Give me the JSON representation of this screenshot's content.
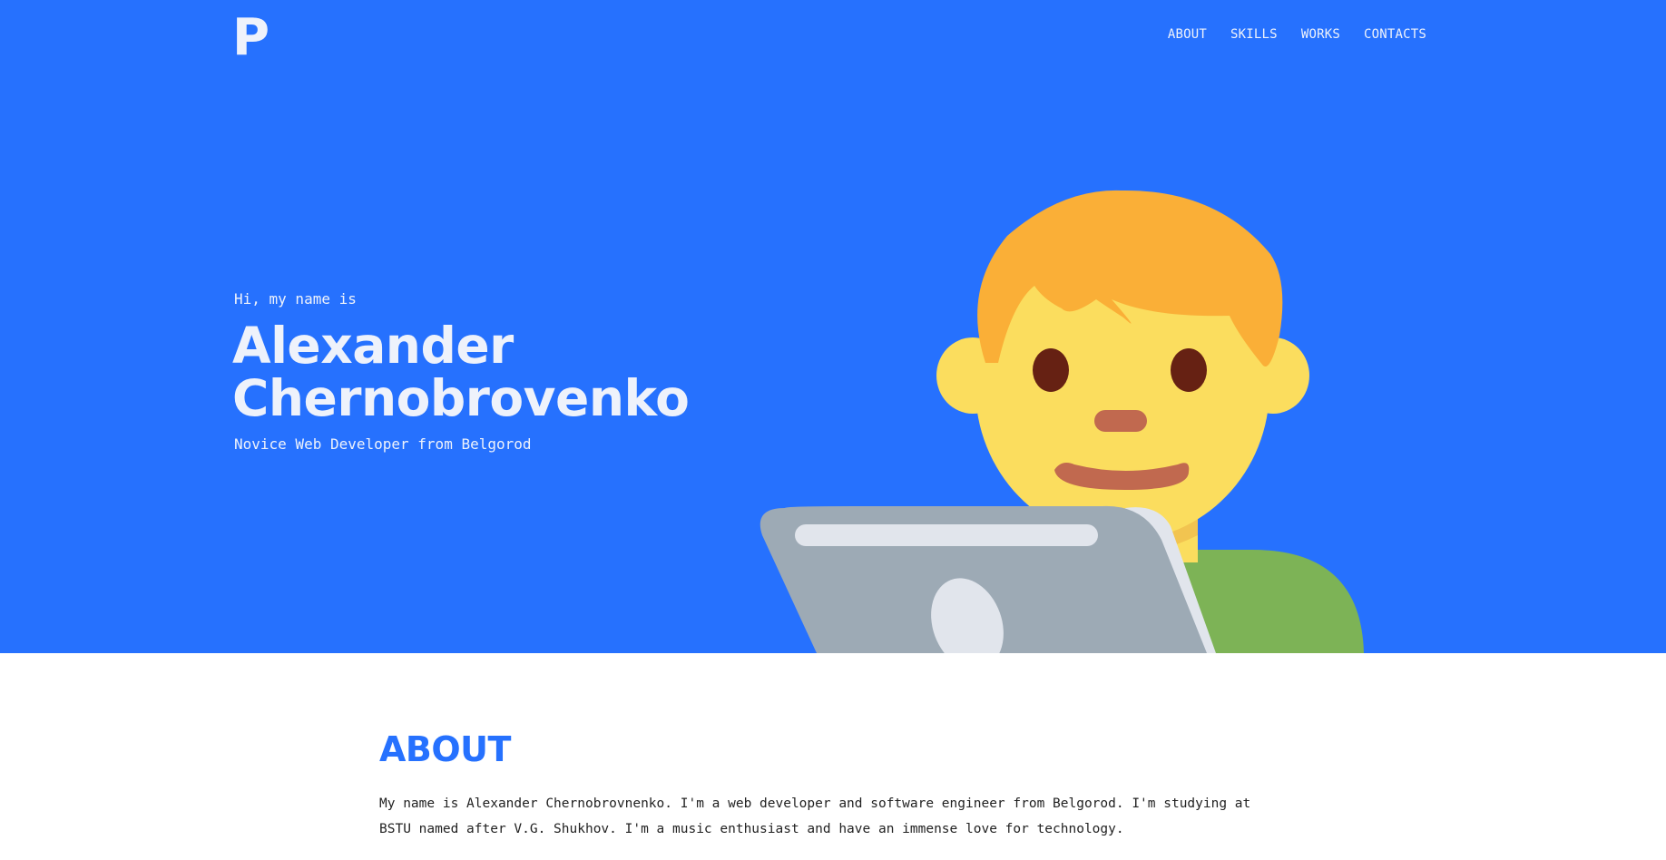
{
  "header": {
    "logo": "P",
    "nav": [
      {
        "label": "ABOUT"
      },
      {
        "label": "SKILLS"
      },
      {
        "label": "WORKS"
      },
      {
        "label": "CONTACTS"
      }
    ]
  },
  "hero": {
    "greeting": "Hi, my name is",
    "name": "Alexander Chernobrovenko",
    "subtitle": "Novice Web Developer from Belgorod",
    "illustration": "man-technologist-emoji"
  },
  "about": {
    "title": "ABOUT",
    "text": "My name is Alexander Chernobrovnenko. I'm a web developer and software engineer from Belgorod. I'm studying at BSTU named after V.G. Shukhov. I'm a music enthusiast and have an immense love for technology."
  },
  "colors": {
    "accent": "#2671fe",
    "hero_text": "#eef2fb"
  }
}
